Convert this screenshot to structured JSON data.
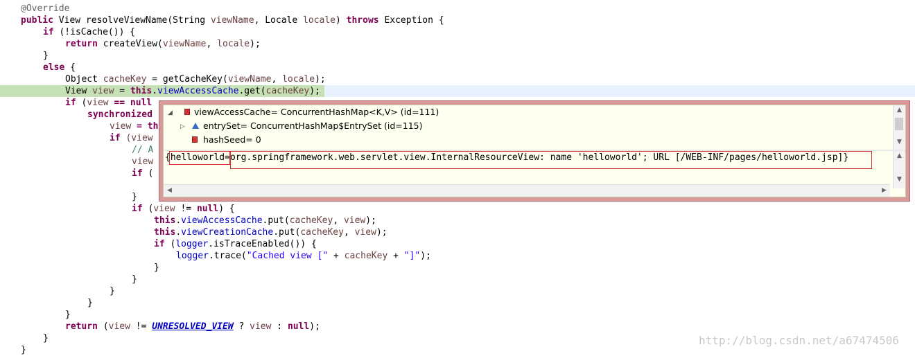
{
  "code": {
    "l1_ann": "@Override",
    "l2_a": "public",
    "l2_b": " View resolveViewName(String ",
    "l2_c": "viewName",
    "l2_d": ", Locale ",
    "l2_e": "locale",
    "l2_f": ") ",
    "l2_g": "throws",
    "l2_h": " Exception {",
    "l3_a": "if",
    "l3_b": " (!isCache()) {",
    "l4_a": "return",
    "l4_b": " createView(",
    "l4_c": "viewName",
    "l4_d": ", ",
    "l4_e": "locale",
    "l4_f": ");",
    "l5": "}",
    "l6_a": "else",
    "l6_b": " {",
    "l7_a": "Object ",
    "l7_b": "cacheKey",
    "l7_c": " = getCacheKey(",
    "l7_d": "viewName",
    "l7_e": ", ",
    "l7_f": "locale",
    "l7_g": ");",
    "l8_a": "View ",
    "l8_b": "view",
    "l8_c": " = ",
    "l8_d": "this",
    "l8_e": ".",
    "l8_f": "viewAccessCache",
    "l8_g": ".get(",
    "l8_h": "cacheKey",
    "l8_i": ");",
    "l9_a": "if",
    "l9_b": " (",
    "l9_c": "view",
    "l9_d": " == null",
    "l10": "synchronized",
    "l11_a": "view",
    "l11_b": " = th",
    "l12_a": "if",
    "l12_b": " (view",
    "l13": "// A",
    "l14": "view",
    "l15_a": "if",
    "l15_b": " (",
    "l16": "}",
    "l17_a": "if",
    "l17_b": " (",
    "l17_c": "view",
    "l17_d": " != ",
    "l17_e": "null",
    "l17_f": ") {",
    "l18_a": "this",
    "l18_b": ".",
    "l18_c": "viewAccessCache",
    "l18_d": ".put(",
    "l18_e": "cacheKey",
    "l18_f": ", ",
    "l18_g": "view",
    "l18_h": ");",
    "l19_a": "this",
    "l19_b": ".",
    "l19_c": "viewCreationCache",
    "l19_d": ".put(",
    "l19_e": "cacheKey",
    "l19_f": ", ",
    "l19_g": "view",
    "l19_h": ");",
    "l20_a": "if",
    "l20_b": " (",
    "l20_c": "logger",
    "l20_d": ".isTraceEnabled()) {",
    "l21_a": "logger",
    "l21_b": ".trace(",
    "l21_c": "\"Cached view [\"",
    "l21_d": " + ",
    "l21_e": "cacheKey",
    "l21_f": " + ",
    "l21_g": "\"]\"",
    "l21_h": ");",
    "close": "}",
    "l28_a": "return",
    "l28_b": " (",
    "l28_c": "view",
    "l28_d": " != ",
    "l28_e": "UNRESOLVED_VIEW",
    "l28_f": " ? ",
    "l28_g": "view",
    "l28_h": " : ",
    "l28_i": "null",
    "l28_j": ");"
  },
  "popup": {
    "root_label": "viewAccessCache= ConcurrentHashMap<K,V>  (id=111)",
    "child1_label": "entrySet= ConcurrentHashMap$EntrySet  (id=115)",
    "child2_label": "hashSeed= 0",
    "detail_open": "{",
    "detail_key": "helloworld",
    "detail_eq": "=",
    "detail_value": "org.springframework.web.servlet.view.InternalResourceView: name 'helloworld'; URL [/WEB-INF/pages/helloworld.jsp]}"
  },
  "watermark": "http://blog.csdn.net/a67474506"
}
